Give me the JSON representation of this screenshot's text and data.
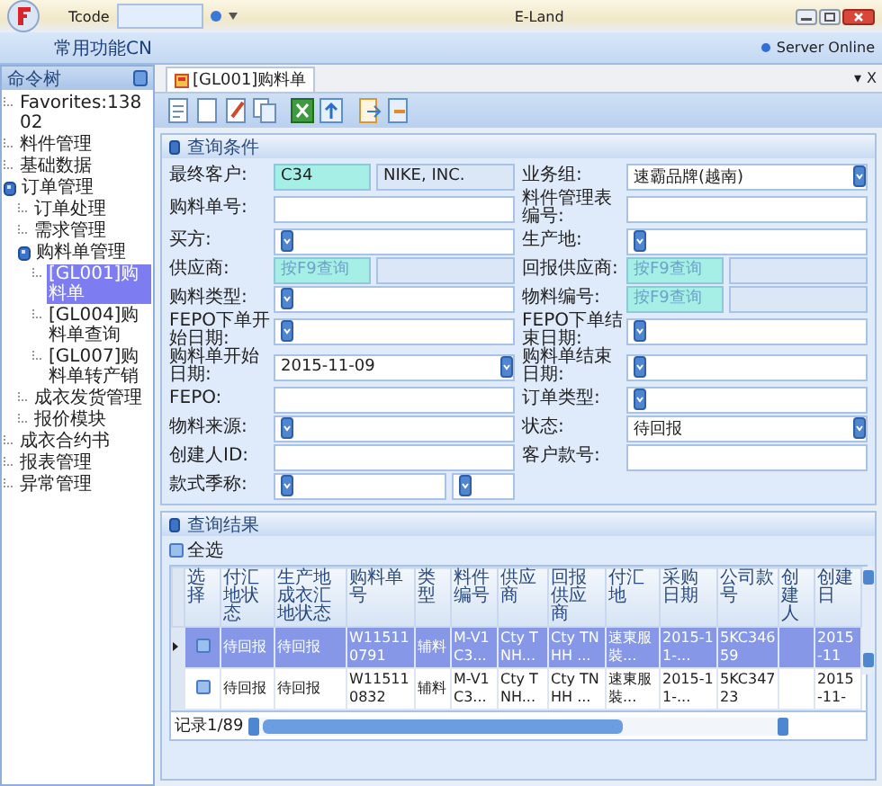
{
  "window": {
    "title": "E-Land",
    "tcode_label": "Tcode"
  },
  "ribbon": {
    "menu": "常用功能CN",
    "server_status": "Server Online"
  },
  "sidebar": {
    "title": "命令树",
    "items": [
      {
        "label": "Favorites:13802",
        "selected": false
      },
      {
        "label": "料件管理",
        "selected": false
      },
      {
        "label": "基础数据",
        "selected": false
      },
      {
        "label": "订单管理",
        "selected": false,
        "children": [
          {
            "label": "订单处理",
            "selected": false
          },
          {
            "label": "需求管理",
            "selected": false
          },
          {
            "label": "购料单管理",
            "selected": false,
            "children": [
              {
                "label": "[GL001]购料单",
                "selected": true
              },
              {
                "label": "[GL004]购料单查询",
                "selected": false
              },
              {
                "label": "[GL007]购料单转产销",
                "selected": false
              }
            ]
          },
          {
            "label": "成衣发货管理",
            "selected": false
          },
          {
            "label": "报价模块",
            "selected": false
          }
        ]
      },
      {
        "label": "成衣合约书",
        "selected": false
      },
      {
        "label": "报表管理",
        "selected": false
      },
      {
        "label": "异常管理",
        "selected": false
      }
    ]
  },
  "tabs": [
    {
      "label": "[GL001]购料单",
      "selected": true
    }
  ],
  "tab_controls": [
    "▾",
    "X"
  ],
  "query_panel": {
    "title": "查询条件",
    "rows": [
      [
        {
          "label": "最终客户:",
          "kind": "lookup",
          "value": "C34",
          "desc": "NIKE, INC."
        },
        {
          "label": "业务组:",
          "kind": "dropdown",
          "value": "速霸品牌(越南)"
        }
      ],
      [
        {
          "label": "购料单号:",
          "kind": "text"
        },
        {
          "label": "料件管理表编号:",
          "kind": "text"
        }
      ],
      [
        {
          "label": "买方:",
          "kind": "dropdown"
        },
        {
          "label": "生产地:",
          "kind": "dropdown"
        }
      ],
      [
        {
          "label": "供应商:",
          "kind": "lookup",
          "placeholder": "按F9查询"
        },
        {
          "label": "回报供应商:",
          "kind": "lookup",
          "placeholder": "按F9查询"
        }
      ],
      [
        {
          "label": "购料类型:",
          "kind": "dropdown"
        },
        {
          "label": "物料编号:",
          "kind": "lookup",
          "placeholder": "按F9查询"
        }
      ],
      [
        {
          "label": "FEPO下单开始日期:",
          "kind": "dropdown"
        },
        {
          "label": "FEPO下单结束日期:",
          "kind": "dropdown"
        }
      ],
      [
        {
          "label": "购料单开始日期:",
          "kind": "dropdown",
          "value": "2015-11-09"
        },
        {
          "label": "购料单结束日期:",
          "kind": "dropdown"
        }
      ],
      [
        {
          "label": "FEPO:",
          "kind": "text"
        },
        {
          "label": "订单类型:",
          "kind": "dropdown"
        }
      ],
      [
        {
          "label": "物料来源:",
          "kind": "dropdown"
        },
        {
          "label": "状态:",
          "kind": "dropdown",
          "value": "待回报"
        }
      ],
      [
        {
          "label": "创建人ID:",
          "kind": "text"
        },
        {
          "label": "客户款号:",
          "kind": "text"
        }
      ],
      [
        {
          "label": "款式季称:",
          "kind": "dual_dropdown"
        }
      ]
    ]
  },
  "results_panel": {
    "title": "查询结果",
    "select_all": {
      "label": "全选",
      "checked": false
    },
    "table": {
      "columns": [
        "选择",
        "付汇地状态",
        "生产地成衣汇地状态",
        "购料单号",
        "类型",
        "料件编号",
        "供应商",
        "回报供应商",
        "付汇地",
        "采购日期",
        "公司款号",
        "创建人",
        "创建日"
      ],
      "rows": [
        {
          "selected": true,
          "checked": false,
          "cells": [
            "",
            "待回报",
            "待回报",
            "W115110791",
            "辅料",
            "M-V1C3...",
            "Cty TNH...",
            "Cty TNHH ...",
            "速東服裝...",
            "2015-11-...",
            "5KC34659",
            "",
            "2015-11"
          ]
        },
        {
          "selected": false,
          "checked": false,
          "cells": [
            "",
            "待回报",
            "待回报",
            "W115110832",
            "辅料",
            "M-V1C3...",
            "Cty TNH...",
            "Cty TNHH ...",
            "速東服裝...",
            "2015-11-...",
            "5KC34723",
            "",
            "2015-11-"
          ]
        }
      ]
    },
    "record_count": "记录1/89"
  }
}
